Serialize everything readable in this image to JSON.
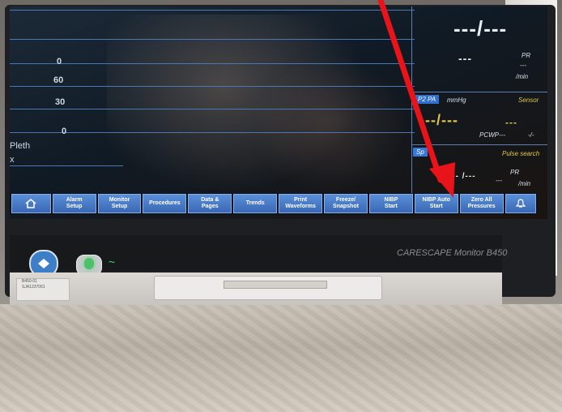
{
  "waveform": {
    "scale_0_top": "0",
    "scale_60": "60",
    "scale_30": "30",
    "scale_0_bottom": "0",
    "pleth_label": "Pleth",
    "pleth_sub": "x"
  },
  "params": {
    "nibp_value": "---/---",
    "pr_value": "---",
    "pr_label": "PR",
    "pr_dash2": "---",
    "pr_unit": "/min",
    "p2_chip": "P2 PA",
    "p2_unit": "mmHg",
    "sensor_label": "Sensor",
    "pa_value": "---/---",
    "pa_mean": "---",
    "pcwp_label": "PCWP",
    "pcwp_value": "---",
    "pcwp_unit": "-/-",
    "spo2_chip": "Sp",
    "pulse_search": "Pulse search",
    "spo2_value": "--- /---",
    "pr2_label": "PR",
    "pr2_value": "---",
    "pr2_unit": "/min"
  },
  "menu": {
    "home_icon": "home-icon",
    "alarm_setup": "Alarm\nSetup",
    "monitor_setup": "Monitor\nSetup",
    "procedures": "Procedures",
    "data_pages": "Data &\nPages",
    "trends": "Trends",
    "print_waveforms": "Print\nWaveforms",
    "freeze_snapshot": "Freeze/\nSnapshot",
    "nibp_start": "NIBP\nStart",
    "nibp_auto_start": "NIBP Auto\nStart",
    "zero_all_pressures": "Zero All\nPressures",
    "last_icon": "alarm-bell-icon"
  },
  "device": {
    "brand": "CARESCAPE Monitor B450",
    "sticker_line1": "B450-01",
    "sticker_line2": "SJA1237061"
  },
  "colors": {
    "arrow": "#e8141a",
    "menu_button": "#4a7cc8",
    "power_led": "#4cc06a"
  }
}
